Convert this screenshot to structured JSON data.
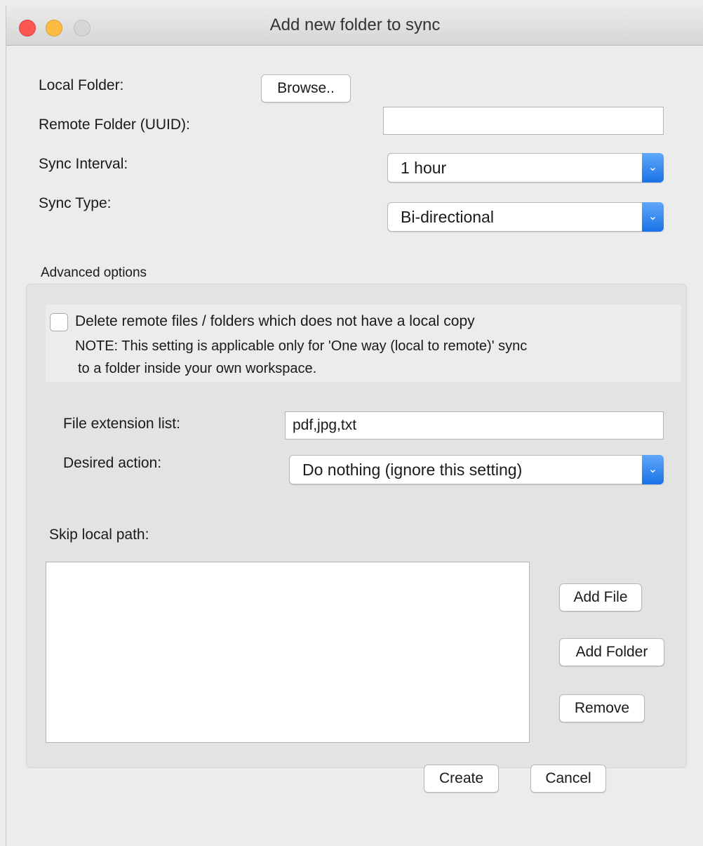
{
  "window": {
    "title": "Add new folder to sync"
  },
  "form": {
    "local_folder_label": "Local Folder:",
    "browse_button": "Browse..",
    "remote_folder_label": "Remote Folder (UUID):",
    "remote_folder_value": "",
    "sync_interval_label": "Sync Interval:",
    "sync_interval_value": "1 hour",
    "sync_type_label": "Sync Type:",
    "sync_type_value": "Bi-directional"
  },
  "advanced": {
    "title": "Advanced options",
    "delete_remote": {
      "checked": false,
      "label": "Delete remote files / folders which does not have a local copy",
      "note_line1": "NOTE: This setting is applicable only for 'One way (local to remote)' sync",
      "note_line2": "to a folder inside your own workspace."
    },
    "file_extension_label": "File extension list:",
    "file_extension_value": "pdf,jpg,txt",
    "desired_action_label": "Desired action:",
    "desired_action_value": "Do nothing (ignore this setting)",
    "skip_local_path_label": "Skip local path:",
    "skip_local_path_items": [],
    "add_file_button": "Add File",
    "add_folder_button": "Add Folder",
    "remove_button": "Remove"
  },
  "footer": {
    "create_button": "Create",
    "cancel_button": "Cancel"
  },
  "colors": {
    "close": "#fc5753",
    "minimize": "#fdbc40",
    "zoom_disabled": "#d6d6d6",
    "select_accent": "#1a72e8"
  },
  "icons": {
    "select_arrow": "chevron-down-icon"
  }
}
